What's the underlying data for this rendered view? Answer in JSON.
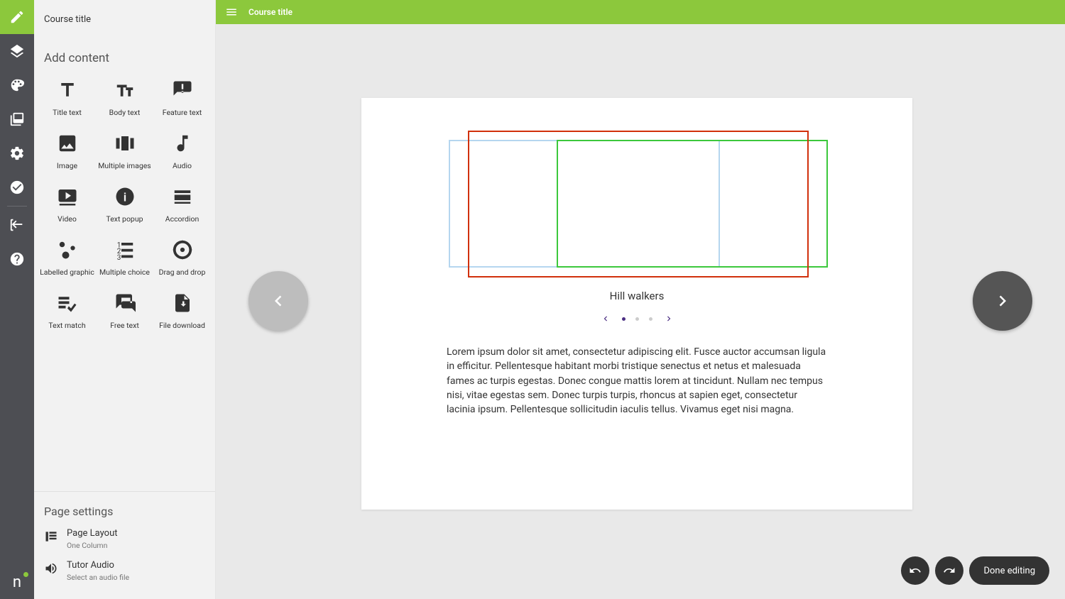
{
  "sidebar": {
    "title": "Course title",
    "section_label": "Add content",
    "items": [
      {
        "label": "Title text",
        "icon": "title-text-icon"
      },
      {
        "label": "Body text",
        "icon": "body-text-icon"
      },
      {
        "label": "Feature text",
        "icon": "feature-text-icon"
      },
      {
        "label": "Image",
        "icon": "image-icon"
      },
      {
        "label": "Multiple images",
        "icon": "multiple-images-icon"
      },
      {
        "label": "Audio",
        "icon": "audio-icon"
      },
      {
        "label": "Video",
        "icon": "video-icon"
      },
      {
        "label": "Text popup",
        "icon": "text-popup-icon"
      },
      {
        "label": "Accordion",
        "icon": "accordion-icon"
      },
      {
        "label": "Labelled graphic",
        "icon": "labelled-graphic-icon"
      },
      {
        "label": "Multiple choice",
        "icon": "multiple-choice-icon"
      },
      {
        "label": "Drag and drop",
        "icon": "drag-and-drop-icon"
      },
      {
        "label": "Text match",
        "icon": "text-match-icon"
      },
      {
        "label": "Free text",
        "icon": "free-text-icon"
      },
      {
        "label": "File download",
        "icon": "file-download-icon"
      }
    ],
    "settings": {
      "title": "Page settings",
      "layout_label": "Page Layout",
      "layout_value": "One Column",
      "audio_label": "Tutor Audio",
      "audio_value": "Select an audio file"
    }
  },
  "topbar": {
    "title": "Course title"
  },
  "canvas": {
    "caption": "Hill walkers",
    "body": "Lorem ipsum dolor sit amet, consectetur adipiscing elit. Fusce auctor accumsan ligula in efficitur. Pellentesque habitant morbi tristique senectus et netus et malesuada fames ac turpis egestas. Donec congue mattis lorem at tincidunt. Nullam nec tempus nisi, vitae egestas sem. Donec turpis turpis, rhoncus at sapien eget, consectetur lacinia ipsum. Pellentesque sollicitudin iaculis tellus. Vivamus eget nisi magna.",
    "pager": {
      "index": 0,
      "count": 3
    }
  },
  "footer": {
    "done_label": "Done editing"
  }
}
